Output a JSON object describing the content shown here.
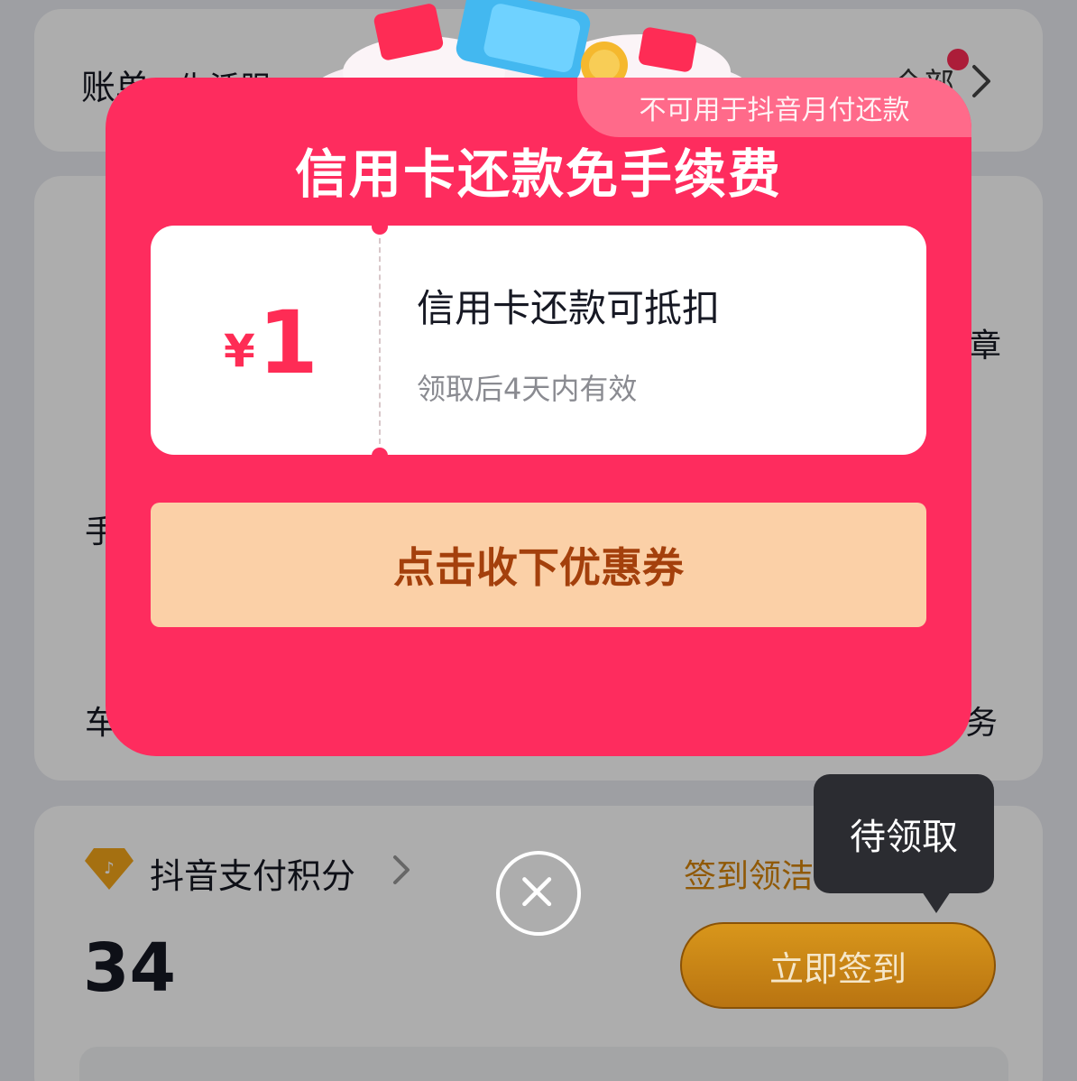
{
  "bill_card": {
    "title": "账单",
    "subtitle": "生活服",
    "all_label": "全部"
  },
  "services_card": {
    "partial_right_top": "章",
    "partial_left_mid": "手",
    "partial_left_bottom": "车",
    "partial_right_bottom": "务"
  },
  "points_card": {
    "label": "抖音支付积分",
    "value": "34",
    "sign_text": "签到领洁",
    "sign_button": "立即签到",
    "tooltip": "待领取"
  },
  "popup": {
    "tab_note": "不可用于抖音月付还款",
    "title": "信用卡还款免手续费",
    "coupon": {
      "currency": "¥",
      "amount": "1",
      "description": "信用卡还款可抵扣",
      "validity": "领取后4天内有效"
    },
    "claim_button": "点击收下优惠券"
  },
  "colors": {
    "popup_bg": "#fe2c5e",
    "claim_button_bg": "#fbd0a7",
    "claim_button_text": "#a4400c",
    "sign_button": "#e9a321"
  },
  "icons": {
    "points": "diamond-badge-icon",
    "close": "close-circle-icon",
    "chevron": "chevron-right-icon"
  }
}
